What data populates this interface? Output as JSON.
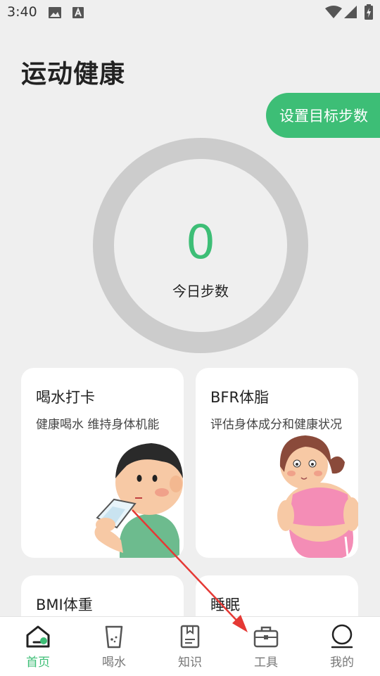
{
  "status_bar": {
    "time": "3:40",
    "icons": [
      "image-icon",
      "text-a-icon",
      "wifi-icon",
      "signal-icon",
      "battery-icon"
    ]
  },
  "page": {
    "title": "运动健康"
  },
  "goal_button": {
    "label": "设置目标步数"
  },
  "steps": {
    "count": "0",
    "label": "今日步数"
  },
  "cards": [
    {
      "title": "喝水打卡",
      "desc": "健康喝水 维持身体机能",
      "art": "drinking-boy-illustration"
    },
    {
      "title": "BFR体脂",
      "desc": "评估身体成分和健康状况",
      "art": "chubby-girl-illustration"
    },
    {
      "title": "BMI体重",
      "desc": ""
    },
    {
      "title": "睡眠",
      "desc": ""
    }
  ],
  "nav": {
    "items": [
      {
        "label": "首页",
        "icon": "home-icon",
        "active": true
      },
      {
        "label": "喝水",
        "icon": "water-cup-icon",
        "active": false
      },
      {
        "label": "知识",
        "icon": "book-icon",
        "active": false
      },
      {
        "label": "工具",
        "icon": "toolbox-icon",
        "active": false
      },
      {
        "label": "我的",
        "icon": "profile-icon",
        "active": false
      }
    ]
  },
  "colors": {
    "accent": "#3dbe76",
    "ring": "#cccccc",
    "background": "#efefef",
    "annotation_arrow": "#e53935"
  }
}
